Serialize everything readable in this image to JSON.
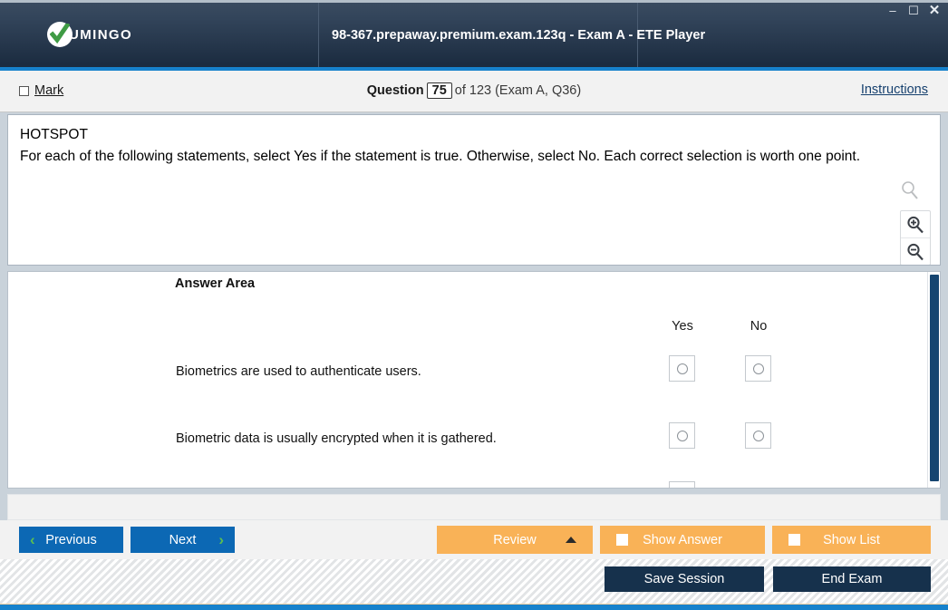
{
  "window": {
    "app_title": "98-367.prepaway.premium.exam.123q - Exam A - ETE Player",
    "logo_text": "UMINGO",
    "controls": {
      "minimize": "–",
      "maximize": "☐",
      "close": "✕"
    },
    "accent_color": "#1782cc",
    "titlebar_color": "#27384d"
  },
  "statusbar": {
    "mark_label": "Mark",
    "question_word": "Question",
    "question_number": "75",
    "of_text": "of 123 (Exam A, Q36)",
    "instructions_link": "Instructions"
  },
  "question": {
    "type_label": "HOTSPOT",
    "body": "For each of the following statements, select Yes if the statement is true. Otherwise, select No. Each correct selection is worth one point.",
    "zoom_tools": [
      "magnifier-icon",
      "zoom-in-icon",
      "zoom-out-icon"
    ]
  },
  "answer_area": {
    "title": "Answer Area",
    "columns": [
      "Yes",
      "No"
    ],
    "rows": [
      {
        "statement": "Biometrics are used to authenticate users.",
        "selected": ""
      },
      {
        "statement": "Biometric data is usually encrypted when it is gathered.",
        "selected": ""
      }
    ]
  },
  "buttons": {
    "previous": "Previous",
    "next": "Next",
    "review": "Review",
    "show_answer": "Show Answer",
    "show_list": "Show List",
    "save_session": "Save Session",
    "end_exam": "End Exam",
    "prev_chevron": "‹",
    "next_chevron": "›",
    "nav_color": "#0c68b4",
    "orange_color": "#f9b257",
    "dark_color": "#16314c"
  }
}
